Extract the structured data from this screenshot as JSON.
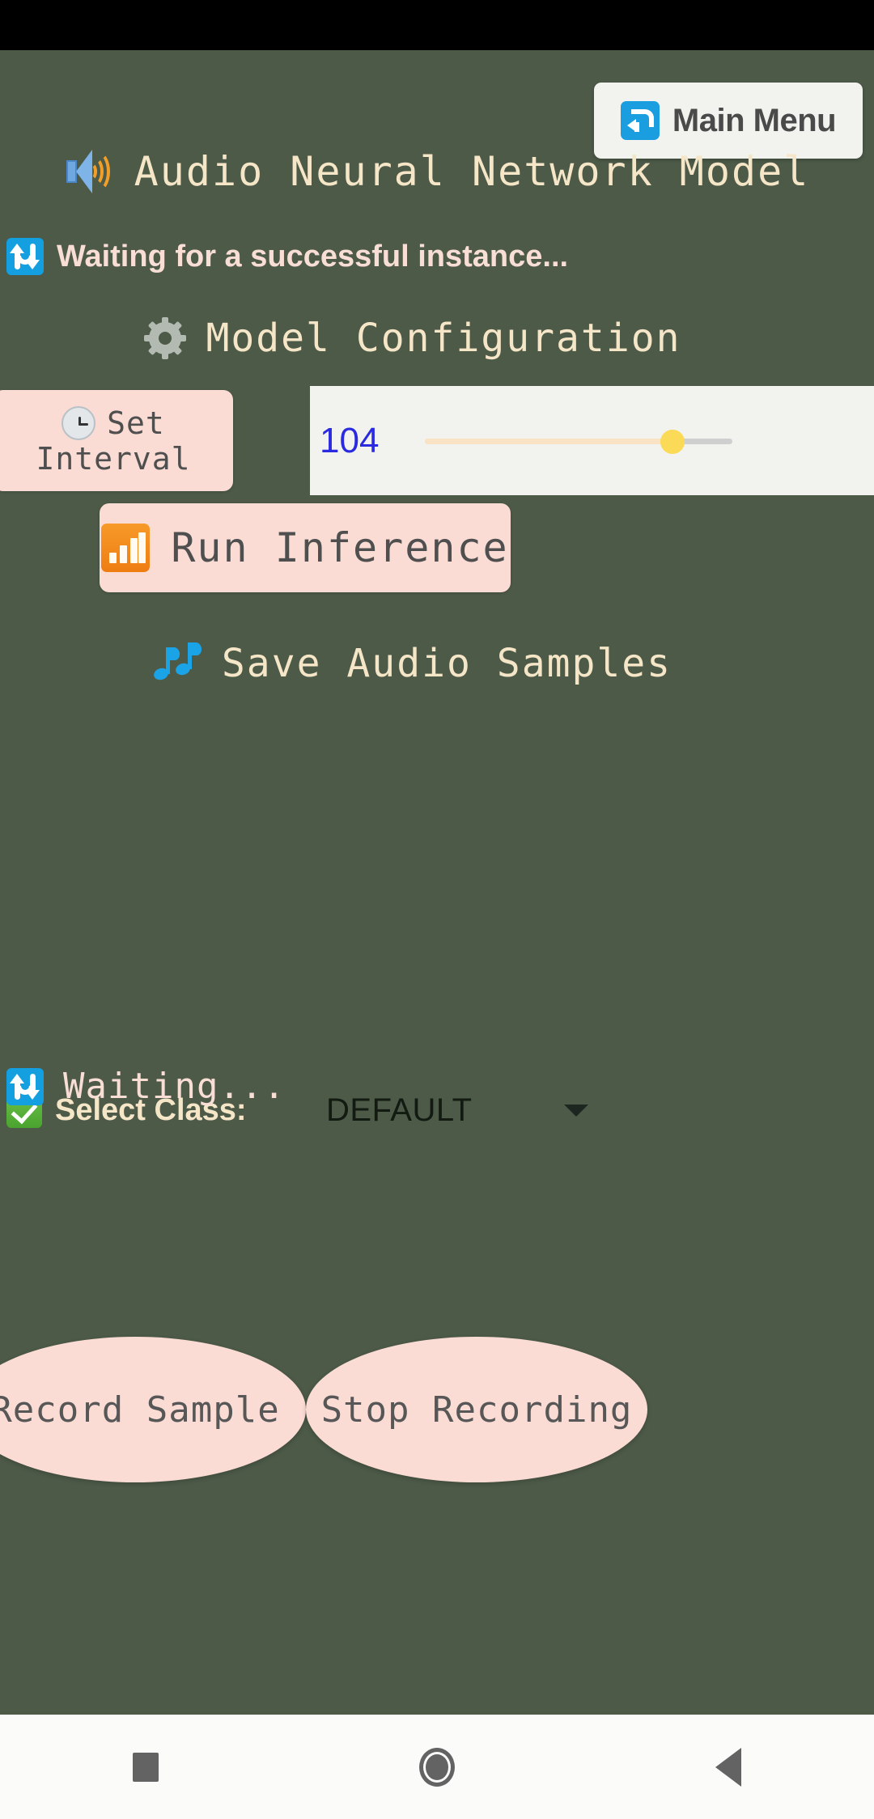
{
  "window": {
    "background_color": "#4d5a48",
    "status_bar_color": "#000000"
  },
  "header": {
    "main_menu_label": "Main Menu",
    "main_menu_icon": "return-arrow-icon",
    "app_title": "Audio Neural Network Model",
    "app_title_icon": "speaker-loud-icon"
  },
  "instance_status": {
    "icon": "sync-arrows-icon",
    "text": "Waiting for a successful instance..."
  },
  "model_configuration": {
    "heading": "Model Configuration",
    "heading_icon": "gear-icon",
    "set_interval": {
      "line1": "Set",
      "line2": "Interval",
      "icon": "clock-icon"
    },
    "interval_slider": {
      "value": "104",
      "value_color": "#2a2ae0",
      "fill_color": "#fae3c4",
      "thumb_color": "#fada57",
      "track_color": "#cfcfcf",
      "percent": 80
    },
    "run_inference": {
      "label": "Run Inference",
      "icon": "bar-chart-icon"
    }
  },
  "save_audio": {
    "heading": "Save Audio Samples",
    "heading_icon": "music-notes-icon"
  },
  "select_class": {
    "icon": "green-check-icon",
    "label": "Select Class:",
    "selected_value": "DEFAULT",
    "caret_icon": "chevron-down-icon"
  },
  "recording_controls": {
    "record_label": "Record Sample",
    "stop_label": "Stop Recording"
  },
  "bottom_status": {
    "icon": "sync-arrows-icon",
    "text": "Waiting..."
  },
  "nav_bar": {
    "recent_icon": "square-recents-icon",
    "home_icon": "circle-home-icon",
    "back_icon": "triangle-back-icon"
  }
}
